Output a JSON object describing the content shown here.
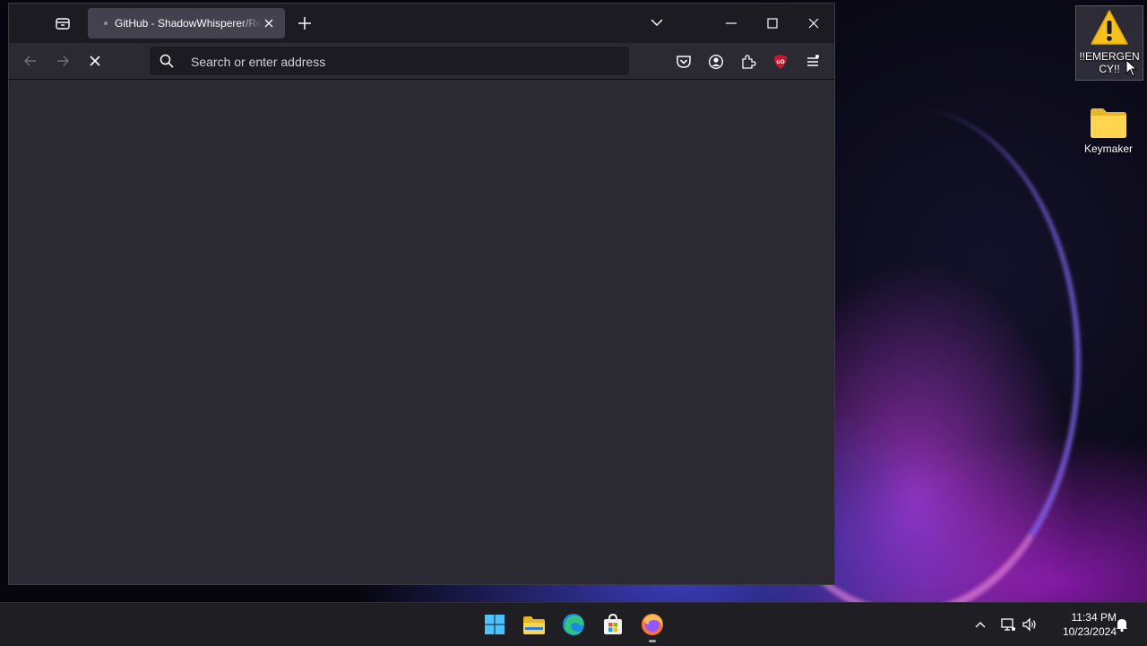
{
  "browser": {
    "tab": {
      "title": "GitHub - ShadowWhisperer/Remove-MS-Edge",
      "close_icon": "close-icon"
    },
    "urlbar": {
      "placeholder": "Search or enter address",
      "value": ""
    },
    "icons": {
      "tab_list": "tab-list-icon",
      "new_tab": "plus-icon",
      "list_all_tabs": "chevron-down-icon",
      "back": "arrow-left-icon",
      "forward": "arrow-right-icon",
      "stop": "stop-icon",
      "search": "search-icon",
      "pocket": "pocket-icon",
      "account": "account-icon",
      "extensions": "puzzle-icon",
      "ublock": "ublock-origin-icon",
      "menu": "hamburger-icon"
    },
    "colors": {
      "tabbar": "#1c1b22",
      "toolbar": "#2b2a33",
      "ublock_red": "#c8192b"
    }
  },
  "desktop": {
    "icons": [
      {
        "label": "!!EMERGENCY!!",
        "icon": "warning-icon",
        "selected": true
      },
      {
        "label": "Keymaker",
        "icon": "folder-icon",
        "selected": false
      }
    ]
  },
  "taskbar": {
    "apps": [
      "windows-start-icon",
      "file-explorer-icon",
      "edge-icon",
      "microsoft-store-icon",
      "firefox-icon"
    ],
    "tray": {
      "time": "11:34 PM",
      "date": "10/23/2024",
      "icons": [
        "chevron-up-icon",
        "network-icon",
        "volume-icon",
        "notification-bell-icon"
      ]
    }
  }
}
